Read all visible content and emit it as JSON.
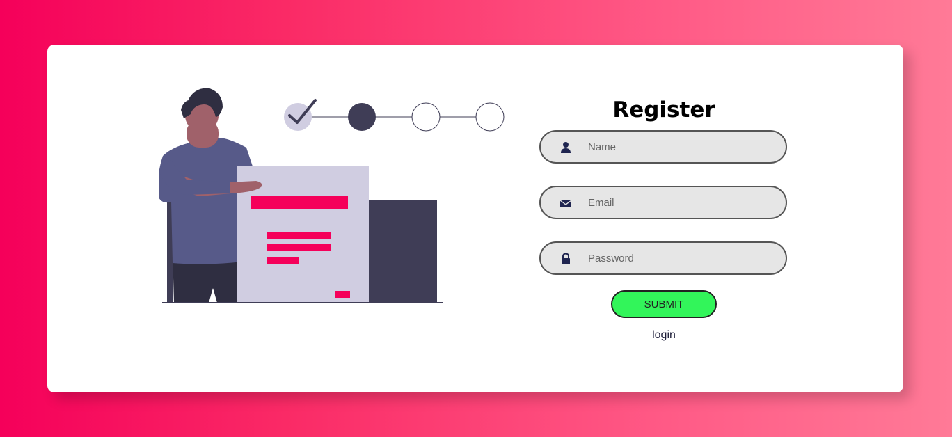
{
  "colors": {
    "background_start": "#f5005a",
    "background_end": "#ff7a97",
    "card": "#ffffff",
    "submit_button": "#32f55a",
    "input_background": "#e6e6e6",
    "accent": "#f5005a"
  },
  "illustration": {
    "progress_steps": [
      "completed",
      "current",
      "pending",
      "pending"
    ]
  },
  "form": {
    "title": "Register",
    "fields": [
      {
        "icon": "user-icon",
        "placeholder": "Name",
        "value": ""
      },
      {
        "icon": "envelope-icon",
        "placeholder": "Email",
        "value": ""
      },
      {
        "icon": "lock-icon",
        "placeholder": "Password",
        "value": ""
      }
    ],
    "submit_label": "SUBMIT",
    "login_label": "login"
  }
}
